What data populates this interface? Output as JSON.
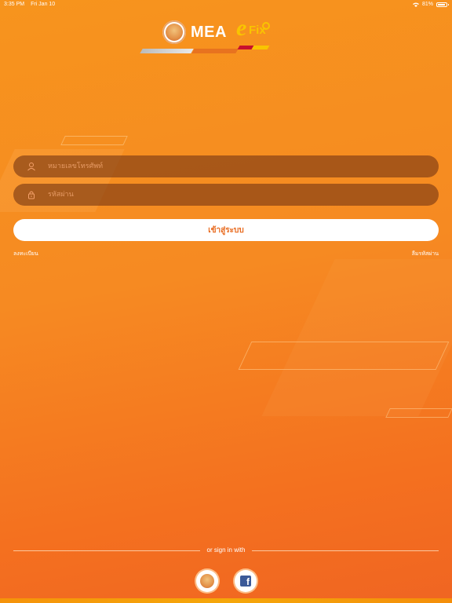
{
  "status_bar": {
    "time": "3:35 PM",
    "date": "Fri Jan 10",
    "battery": "81%",
    "icons": [
      "wifi-icon",
      "battery-icon"
    ]
  },
  "logo": {
    "brand_text": "MEA",
    "brand_e": "e",
    "brand_fix": "Fix",
    "colors": {
      "accent_yellow": "#f9c400",
      "accent_red": "#c8102e"
    }
  },
  "form": {
    "phone_placeholder": "หมายเลขโทรศัพท์",
    "password_placeholder": "รหัสผ่าน",
    "phone_icon": "user-icon",
    "password_icon": "lock-icon",
    "login_label": "เข้าสู่ระบบ"
  },
  "links": {
    "register": "ลงทะเบียน",
    "forgot_password": "ลืมรหัสผ่าน"
  },
  "social": {
    "or_text": "or sign in with",
    "providers": [
      "mea-icon",
      "facebook-icon"
    ]
  },
  "colors": {
    "background_top": "#f7941d",
    "background_bottom": "#f06522",
    "field_bg": "#78371e",
    "button_text": "#e86a1e"
  }
}
